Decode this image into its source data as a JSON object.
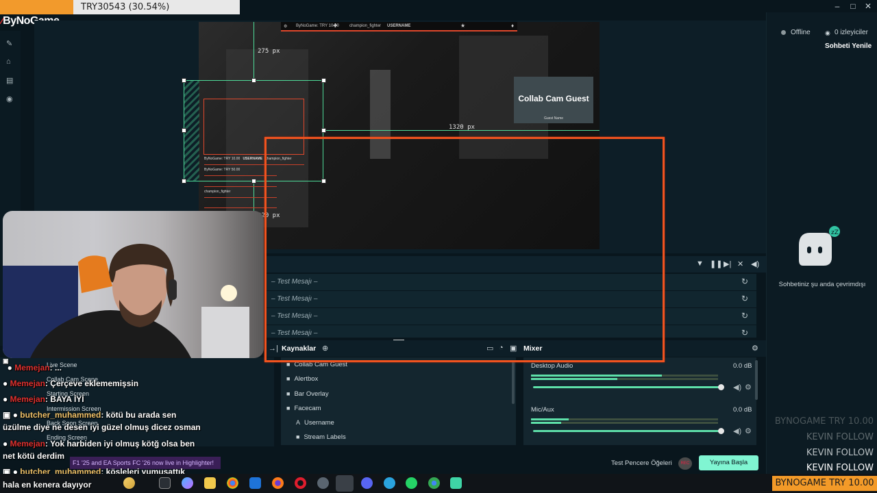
{
  "donation": {
    "text": "TRY30543 (30.54%)",
    "progress_fraction": 0.3054,
    "fill_color": "#f29a2c"
  },
  "brand": {
    "logo_text": "ByNoGame"
  },
  "editor": {
    "measure_top": "275 px",
    "measure_right": "1320 px",
    "measure_bottom": "320 px",
    "collab_cam_title": "Collab Cam Guest",
    "collab_cam_sub": "Guest Name",
    "overlay_top": {
      "item1": "ByNoGame: TRY 10.00",
      "item2": "champion_fighter",
      "item3": "USERNAME"
    },
    "overlay_mini": {
      "row1a": "ByNoGame: TRY 10.00",
      "row1b": "USERNAME",
      "row1c": "champion_fighter",
      "row2": "ByNoGame: TRY 50.00",
      "row4": "champion_fighter"
    }
  },
  "chat_panel": {
    "status": "Offline",
    "viewers": "0 izleyiciler",
    "refresh": "Sohbeti Yenile",
    "sleep_text": "Sohbetiniz şu anda çevrimdışı"
  },
  "alerts": {
    "rows": [
      {
        "text": "– Test Mesajı –"
      },
      {
        "text": "– Test Mesajı –"
      },
      {
        "text": "– Test Mesajı –"
      },
      {
        "text": "– Test Mesajı –"
      }
    ]
  },
  "dock": {
    "sources_title": "Kaynaklar",
    "mixer_title": "Mixer",
    "scenes": [
      "Live Scene",
      "Collab Cam Scene",
      "Starting Screen",
      "Intermission Screen",
      "Back Soon Screen",
      "Ending Screen"
    ],
    "sources": [
      {
        "label": "Collab Cam Guest",
        "icon": "folder-icon"
      },
      {
        "label": "Alertbox",
        "icon": "folder-icon"
      },
      {
        "label": "Bar Overlay",
        "icon": "folder-icon"
      },
      {
        "label": "Facecam",
        "icon": "folder-icon"
      },
      {
        "label": "Username",
        "icon": "text-icon"
      },
      {
        "label": "Stream Labels",
        "icon": "folder-icon"
      }
    ],
    "mixer": [
      {
        "name": "Desktop Audio",
        "db": "0.0 dB"
      },
      {
        "name": "Mic/Aux",
        "db": "0.0 dB"
      }
    ]
  },
  "footer": {
    "test_label": "Test Pencere Öğeleri",
    "go_live": "Yayına Başla",
    "rec_label": "REC"
  },
  "chat_overlay": [
    {
      "user": "Memejan",
      "message": ": ..."
    },
    {
      "user": "Memejan",
      "message": ": Çerçeve eklememişsin"
    },
    {
      "user": "Memejan",
      "message": ": BAYA İYİ"
    },
    {
      "user": "butcher_muhammed",
      "message": ": kötü bu arada sen"
    },
    {
      "user": "",
      "message": "üzülme diye ne desen iyi güzel olmuş dicez osman"
    },
    {
      "user": "Memejan",
      "message": ": Yok harbiden iyi olmuş kötğ olsa ben"
    },
    {
      "user": "",
      "message": "net kötü derdim"
    },
    {
      "user": "butcher_muhammed",
      "message": ": köşleleri yumuşattık"
    },
    {
      "user": "",
      "message": "hala en kenera dayıyor"
    }
  ],
  "notification": {
    "text": "F1 '25 and EA Sports FC '26 now live in Highlighter!"
  },
  "ticker": {
    "lines": [
      {
        "text": "BYNOGAME  TRY 10.00",
        "color": "#4b565a"
      },
      {
        "text": "KEVIN  FOLLOW",
        "color": "#5f6a6e"
      },
      {
        "text": "KEVIN  FOLLOW",
        "color": "#b9c0c3"
      },
      {
        "text": "KEVIN  FOLLOW",
        "color": "#ffffff"
      }
    ],
    "current": "BYNOGAME  TRY 10.00"
  },
  "taskbar": {
    "icons": [
      "start-icon",
      "sparkle-icon",
      "taskview-icon",
      "copilot-icon",
      "explorer-icon",
      "chrome-icon",
      "mail-icon",
      "firefox-icon",
      "opera-icon",
      "obs-icon",
      "streamlabs-icon",
      "discord-icon",
      "telegram-icon",
      "whatsapp-icon",
      "chrome-alt-icon",
      "app-icon"
    ]
  }
}
